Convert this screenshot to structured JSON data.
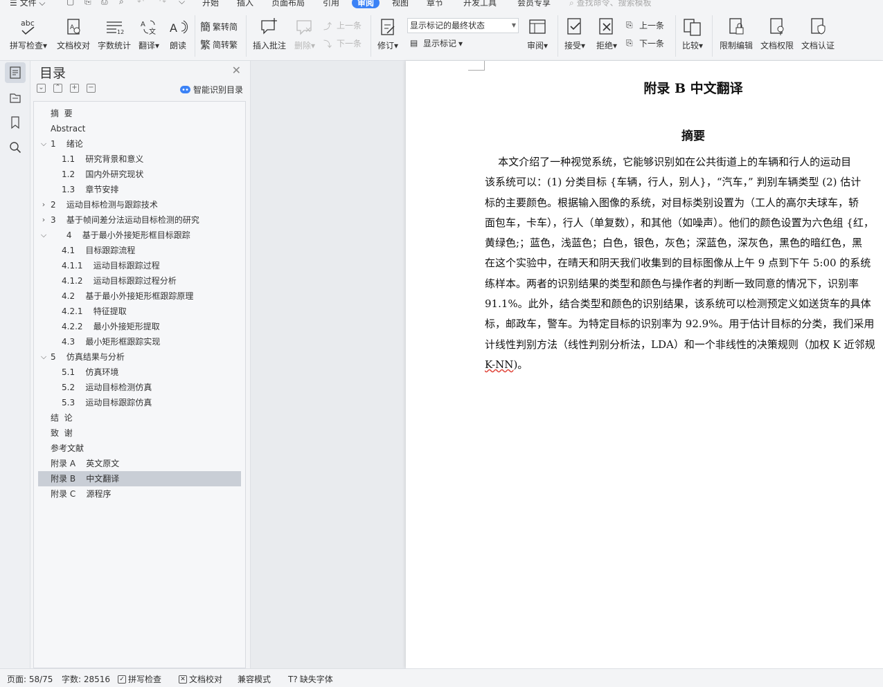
{
  "menubar": {
    "file_label": "文件",
    "tabs": [
      "开始",
      "插入",
      "页面布局",
      "引用",
      "审阅",
      "视图",
      "章节",
      "开发工具",
      "会员专享"
    ],
    "active_tab": "审阅",
    "search_placeholder": "查找命令、搜索模板"
  },
  "ribbon": {
    "spell_check": "拼写检查",
    "doc_proof": "文档校对",
    "word_count": "字数统计",
    "translate": "翻译",
    "read_aloud": "朗读",
    "trad_to_simp": "繁转简",
    "simp_to_trad": "简转繁",
    "insert_comment": "插入批注",
    "delete": "删除",
    "prev_comment": "上一条",
    "next_comment": "下一条",
    "track_changes": "修订",
    "markup_combo": "显示标记的最终状态",
    "show_markup": "显示标记",
    "review": "审阅",
    "accept": "接受",
    "reject": "拒绝",
    "prev_change": "上一条",
    "next_change": "下一条",
    "compare": "比较",
    "restrict_edit": "限制编辑",
    "doc_permission": "文档权限",
    "doc_cert": "文档认证"
  },
  "toc": {
    "title": "目录",
    "smart_label": "智能识别目录",
    "items": [
      {
        "text": "摘  要",
        "level": 0,
        "chev": ""
      },
      {
        "text": "Abstract",
        "level": 0,
        "chev": ""
      },
      {
        "text": "1    绪论",
        "level": 0,
        "chev": "v"
      },
      {
        "text": "1.1    研究背景和意义",
        "level": 1,
        "chev": ""
      },
      {
        "text": "1.2    国内外研究现状",
        "level": 1,
        "chev": ""
      },
      {
        "text": "1.3    章节安排",
        "level": 1,
        "chev": ""
      },
      {
        "text": "2    运动目标检测与跟踪技术",
        "level": 0,
        "chev": ">"
      },
      {
        "text": "3    基于帧间差分法运动目标检测的研究",
        "level": 0,
        "chev": ">"
      },
      {
        "text": "      4    基于最小外接矩形框目标跟踪",
        "level": 0,
        "chev": "v"
      },
      {
        "text": "4.1    目标跟踪流程",
        "level": 1,
        "chev": ""
      },
      {
        "text": "4.1.1    运动目标跟踪过程",
        "level": 1,
        "chev": ""
      },
      {
        "text": "4.1.2    运动目标跟踪过程分析",
        "level": 1,
        "chev": ""
      },
      {
        "text": "4.2    基于最小外接矩形框跟踪原理",
        "level": 1,
        "chev": ""
      },
      {
        "text": "4.2.1    特征提取",
        "level": 1,
        "chev": ""
      },
      {
        "text": "4.2.2    最小外接矩形提取",
        "level": 1,
        "chev": ""
      },
      {
        "text": "4.3    最小矩形框跟踪实现",
        "level": 1,
        "chev": ""
      },
      {
        "text": "5    仿真结果与分析",
        "level": 0,
        "chev": "v"
      },
      {
        "text": "5.1    仿真环境",
        "level": 1,
        "chev": ""
      },
      {
        "text": "5.2    运动目标检测仿真",
        "level": 1,
        "chev": ""
      },
      {
        "text": "5.3    运动目标跟踪仿真",
        "level": 1,
        "chev": ""
      },
      {
        "text": "结  论",
        "level": 0,
        "chev": ""
      },
      {
        "text": "致  谢",
        "level": 0,
        "chev": ""
      },
      {
        "text": "参考文献",
        "level": 0,
        "chev": ""
      },
      {
        "text": "附录 A    英文原文",
        "level": 0,
        "chev": ""
      },
      {
        "text": "附录 B    中文翻译",
        "level": 0,
        "chev": "",
        "selected": true
      },
      {
        "text": "附录 C    源程序",
        "level": 0,
        "chev": ""
      }
    ]
  },
  "document": {
    "heading": "附录 B    中文翻译",
    "subheading": "摘要",
    "lines": [
      "    本文介绍了一种视觉系统，它能够识别如在公共街道上的车辆和行人的运动目",
      "该系统可以：(1) 分类目标 {车辆，行人，别人}，“汽车，” 判别车辆类型 (2) 估计",
      "标的主要颜色。根据输入图像的系统，对目标类别设置为（工人的高尔夫球车，轿",
      "面包车，卡车），行人（单复数），和其他（如噪声）。他们的颜色设置为六色组 {红，",
      "黄绿色;；蓝色，浅蓝色；白色，银色，灰色；深蓝色，深灰色，黑色的暗红色，黑",
      "在这个实验中，在晴天和阴天我们收集到的目标图像从上午 9 点到下午 5:00 的系统",
      "练样本。两者的识别结果的类型和颜色与操作者的判断一致同意的情况下，识别率",
      "91.1%。此外，结合类型和颜色的识别结果，该系统可以检测预定义如送货车的具体",
      "标，邮政车，警车。为特定目标的识别率为 92.9%。用于估计目标的分类，我们采用",
      "计线性判别方法（线性判别分析法，LDA）和一个非线性的决策规则（加权 K 近邻规"
    ],
    "last_line": "K-NN",
    "last_line_tail": ")。"
  },
  "statusbar": {
    "page": "页面: 58/75",
    "words": "字数: 28516",
    "spell": "拼写检查",
    "proof": "文档校对",
    "compat": "兼容模式",
    "missing_font": "缺失字体"
  }
}
